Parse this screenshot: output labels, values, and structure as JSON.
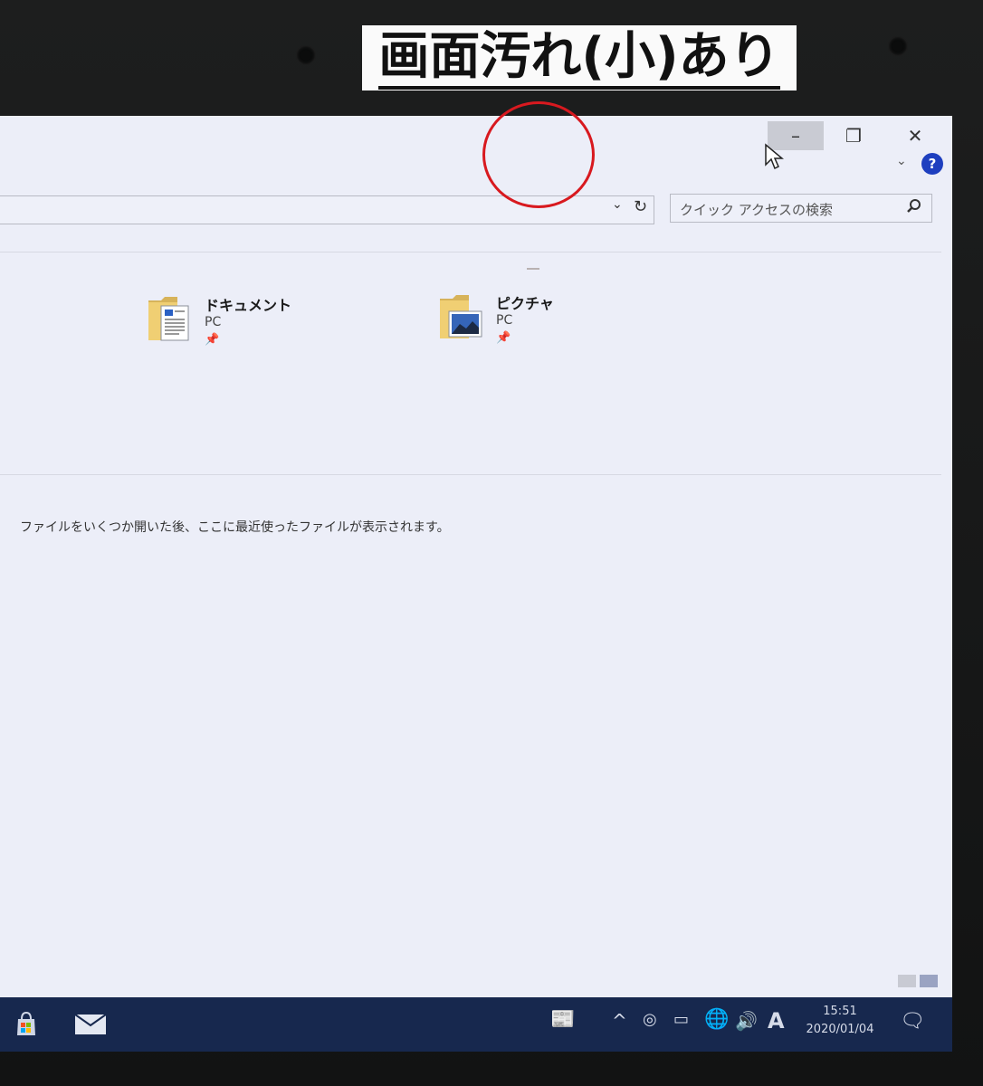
{
  "annotation": {
    "text": "画面汚れ(小)あり"
  },
  "window": {
    "minimize": "–",
    "maximize": "❐",
    "close": "✕",
    "ribbon_expand": "⌄",
    "help": "?"
  },
  "address_bar": {
    "dropdown": "⌄",
    "refresh": "↻"
  },
  "search": {
    "placeholder": "クイック アクセスの検索",
    "icon": "search-icon"
  },
  "frequent_folders": [
    {
      "name": "ドキュメント",
      "location": "PC",
      "pinned": true
    },
    {
      "name": "ピクチャ",
      "location": "PC",
      "pinned": true
    }
  ],
  "recent_files": {
    "empty_message": "ファイルをいくつか開いた後、ここに最近使ったファイルが表示されます。"
  },
  "taskbar": {
    "time": "15:51",
    "date": "2020/01/04",
    "ime": "A"
  },
  "colors": {
    "accent": "#1e3fbf",
    "taskbar": "#17284e",
    "annotation_circle": "#d8191f"
  }
}
